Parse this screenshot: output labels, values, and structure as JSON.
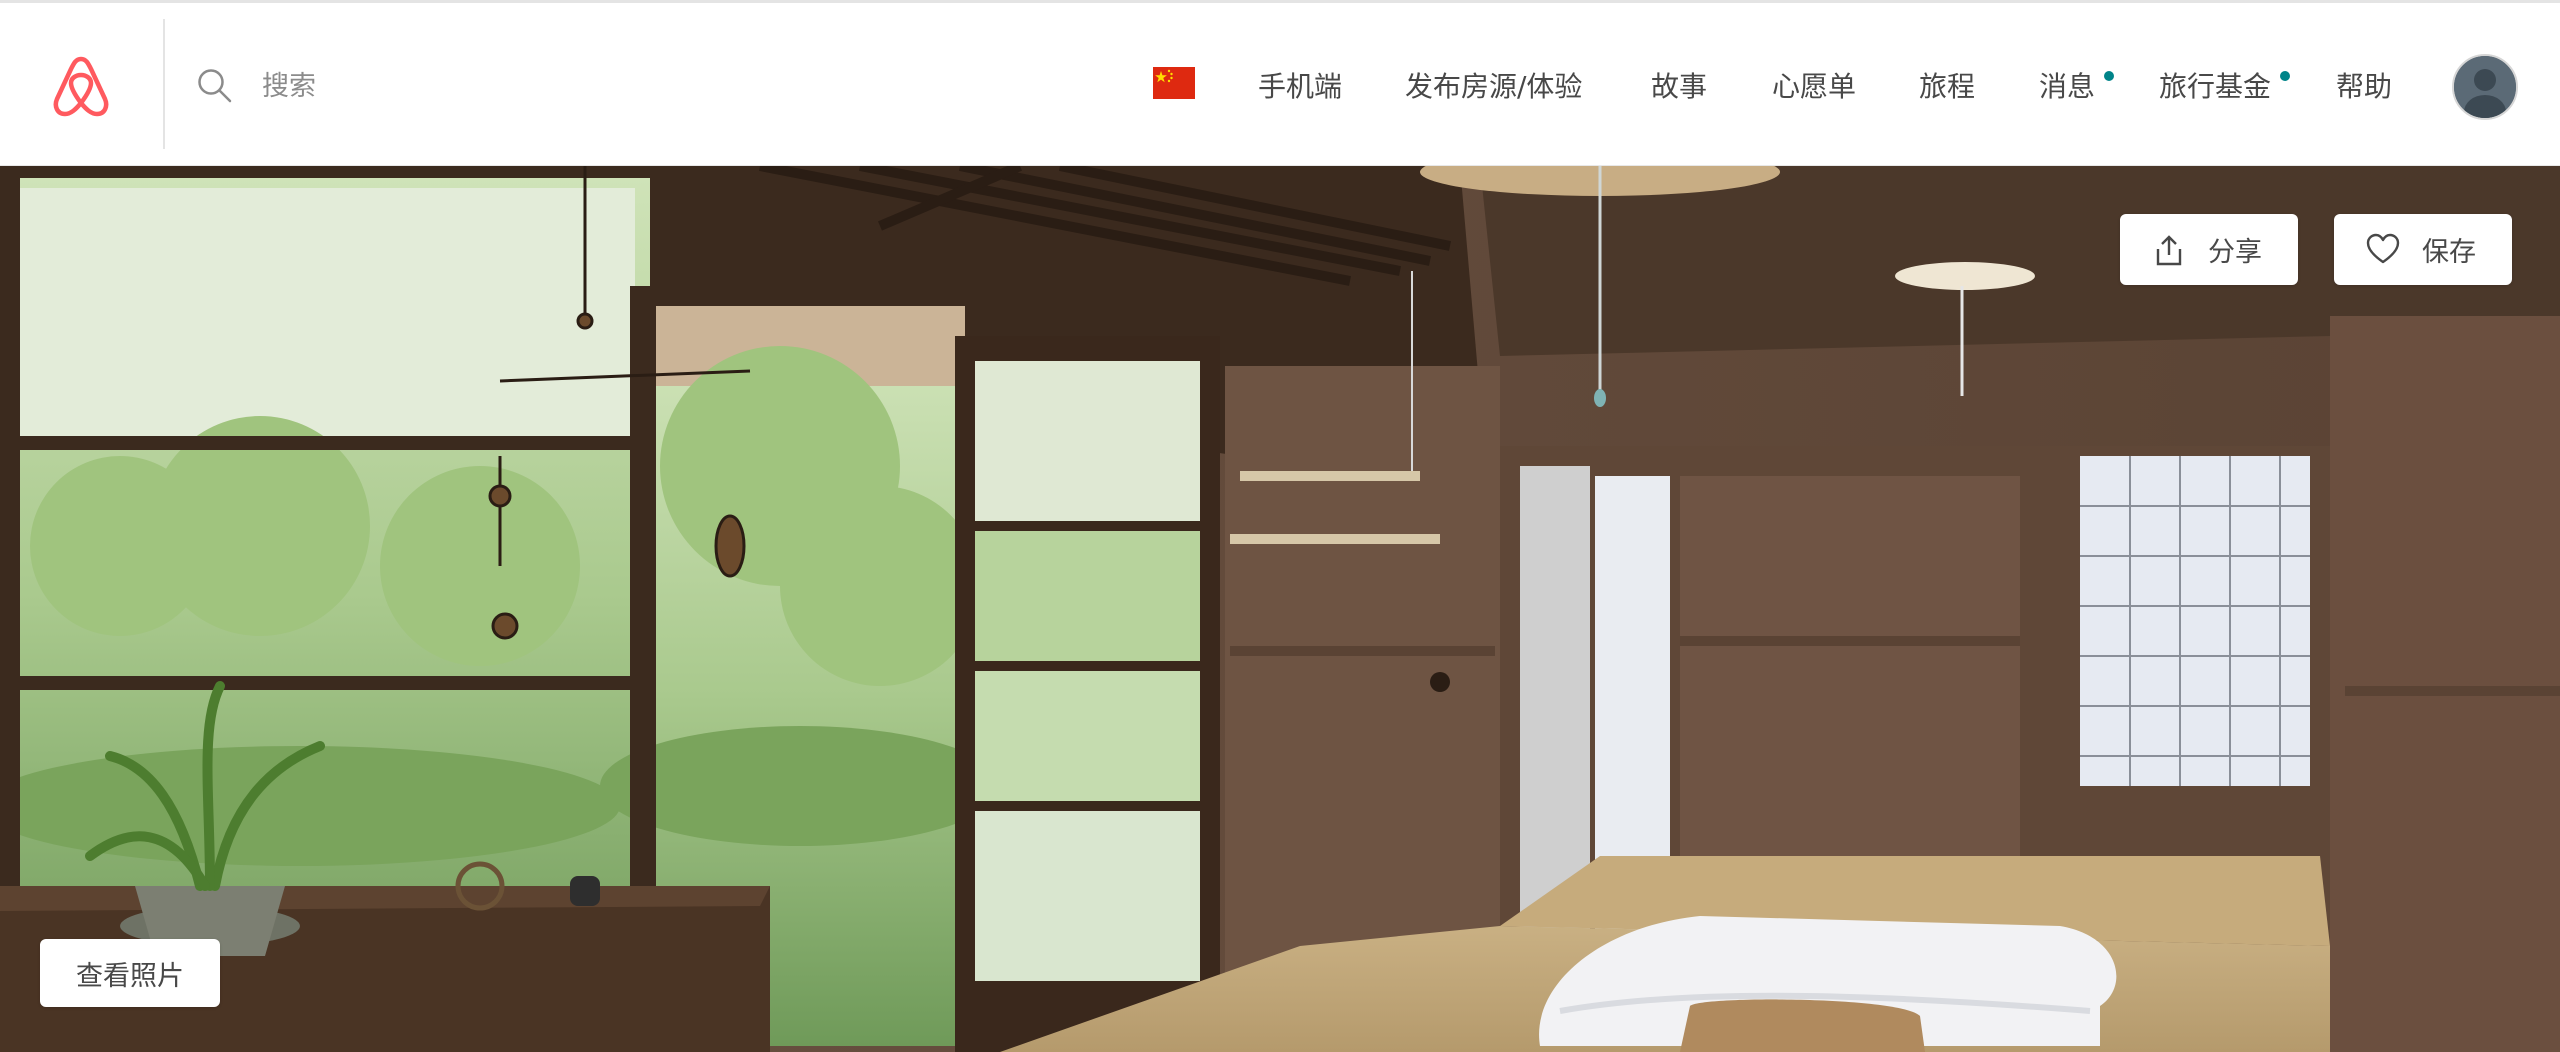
{
  "header": {
    "logo_icon": "airbnb-belo-icon",
    "brand_color": "#FF5A5F",
    "search": {
      "placeholder": "搜索",
      "value": "",
      "icon": "search-icon"
    },
    "language_flag": "china-flag-icon",
    "nav": [
      {
        "label": "手机端",
        "badge": false
      },
      {
        "label": "发布房源/体验",
        "badge": false
      },
      {
        "label": "故事",
        "badge": false
      },
      {
        "label": "心愿单",
        "badge": false
      },
      {
        "label": "旅程",
        "badge": false
      },
      {
        "label": "消息",
        "badge": true
      },
      {
        "label": "旅行基金",
        "badge": true
      },
      {
        "label": "帮助",
        "badge": false
      }
    ],
    "badge_color": "#008489",
    "avatar_icon": "user-avatar"
  },
  "hero": {
    "share_button": {
      "label": "分享",
      "icon": "share-icon"
    },
    "save_button": {
      "label": "保存",
      "icon": "heart-icon"
    },
    "view_photos_button": {
      "label": "查看照片"
    }
  }
}
